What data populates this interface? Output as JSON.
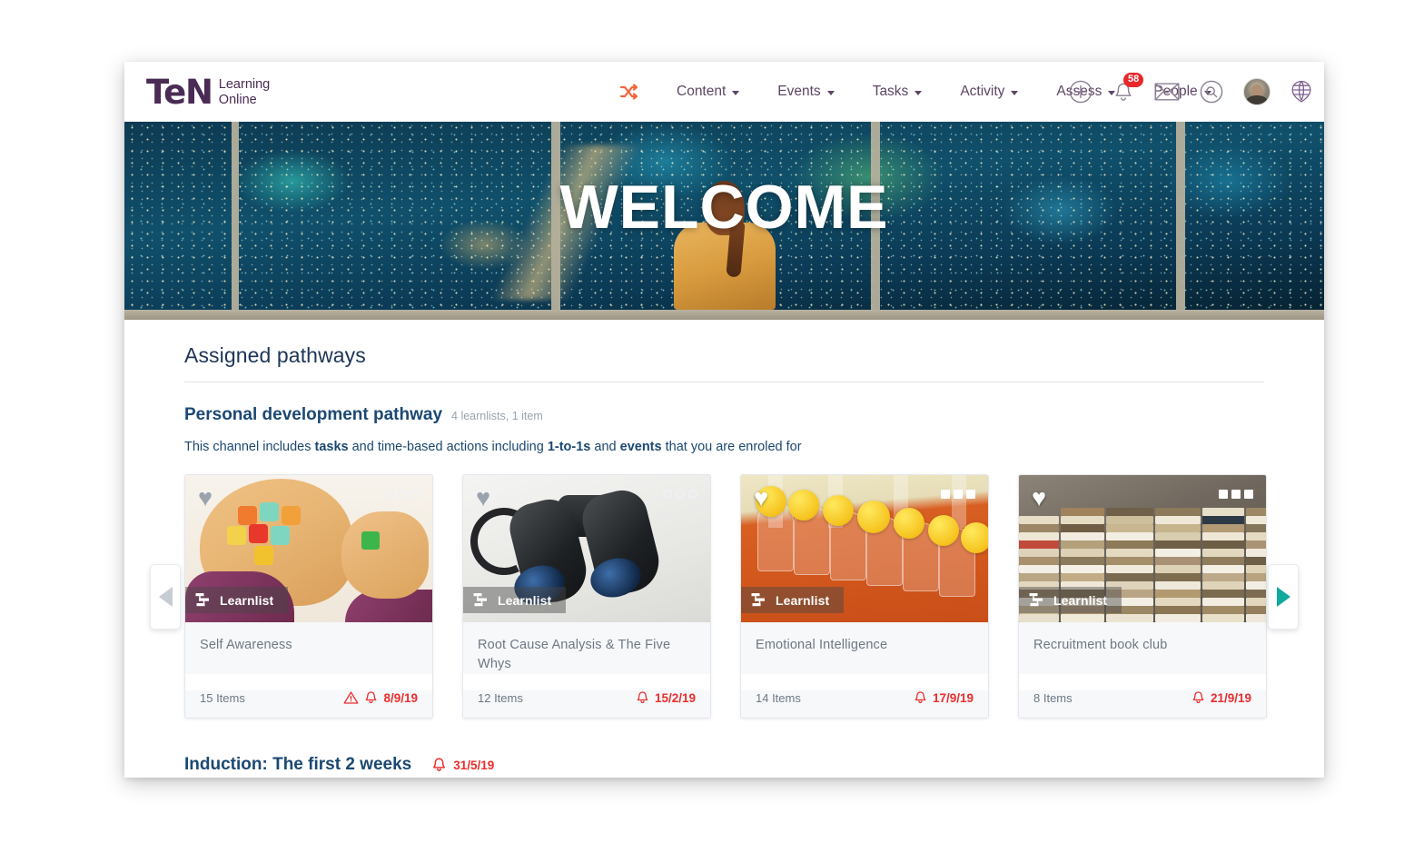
{
  "brand": {
    "mark": "TeN",
    "line1": "Learning",
    "line2": "Online"
  },
  "nav": {
    "shuffle_icon": "shuffle-icon",
    "items": [
      {
        "label": "Content",
        "has_caret": true
      },
      {
        "label": "Events",
        "has_caret": true
      },
      {
        "label": "Tasks",
        "has_caret": true
      },
      {
        "label": "Activity",
        "has_caret": true
      },
      {
        "label": "Assess",
        "has_caret": true
      },
      {
        "label": "People",
        "has_caret": true
      }
    ],
    "icons": [
      {
        "name": "add-icon",
        "glyph": "+"
      },
      {
        "name": "notifications-bell-icon",
        "badge": "58"
      },
      {
        "name": "messages-envelope-icon"
      },
      {
        "name": "search-icon"
      },
      {
        "name": "user-avatar"
      },
      {
        "name": "language-globe-icon"
      }
    ]
  },
  "hero": {
    "welcome_text": "WELCOME"
  },
  "main": {
    "section_title": "Assigned pathways",
    "pathway": {
      "title": "Personal development pathway",
      "meta": "4 learnlists, 1 item",
      "description_parts": [
        {
          "text": "This channel includes ",
          "bold": false
        },
        {
          "text": "tasks",
          "bold": true
        },
        {
          "text": " and time-based actions including ",
          "bold": false
        },
        {
          "text": "1-to-1s",
          "bold": true
        },
        {
          "text": " and ",
          "bold": false
        },
        {
          "text": "events",
          "bold": true
        },
        {
          "text": " that you are enroled for",
          "bold": false
        }
      ],
      "description_plain": "This channel includes tasks and time-based actions including 1-to-1s and events that you are enroled for"
    },
    "cards": [
      {
        "tag": "Learnlist",
        "title": "Self Awareness",
        "items": "15 Items",
        "due_date": "8/9/19",
        "has_warning": true,
        "has_bell": true,
        "favourite": "grey",
        "menu_style": "hollow",
        "image": "puzzle-head-illustration"
      },
      {
        "tag": "Learnlist",
        "title": "Root Cause Analysis & The Five Whys",
        "items": "12 Items",
        "due_date": "15/2/19",
        "has_warning": false,
        "has_bell": true,
        "favourite": "grey",
        "menu_style": "hollow",
        "image": "binoculars-photo"
      },
      {
        "tag": "Learnlist",
        "title": "Emotional Intelligence",
        "items": "14 Items",
        "due_date": "17/9/19",
        "has_warning": false,
        "has_bell": true,
        "favourite": "white",
        "menu_style": "solid",
        "image": "smiley-faces-photo"
      },
      {
        "tag": "Learnlist",
        "title": "Recruitment book club",
        "items": "8 Items",
        "due_date": "21/9/19",
        "has_warning": false,
        "has_bell": true,
        "favourite": "white",
        "menu_style": "solid",
        "image": "stacked-books-photo"
      }
    ],
    "carousel": {
      "prev_label": "Previous",
      "next_label": "Next",
      "prev_enabled": false,
      "next_enabled": true
    },
    "induction": {
      "title": "Induction: The first 2 weeks",
      "due_date": "31/5/19"
    }
  },
  "colors": {
    "brand_purple": "#4a2b55",
    "heading_navy": "#1d3557",
    "link_navy": "#1b4872",
    "due_red": "#ec2d2d",
    "badge_red": "#e8272b",
    "accent_teal": "#10a99c",
    "shuffle_orange": "#f4653c",
    "card_body_grey": "#f6f8fa",
    "muted_text": "#6e7884"
  }
}
